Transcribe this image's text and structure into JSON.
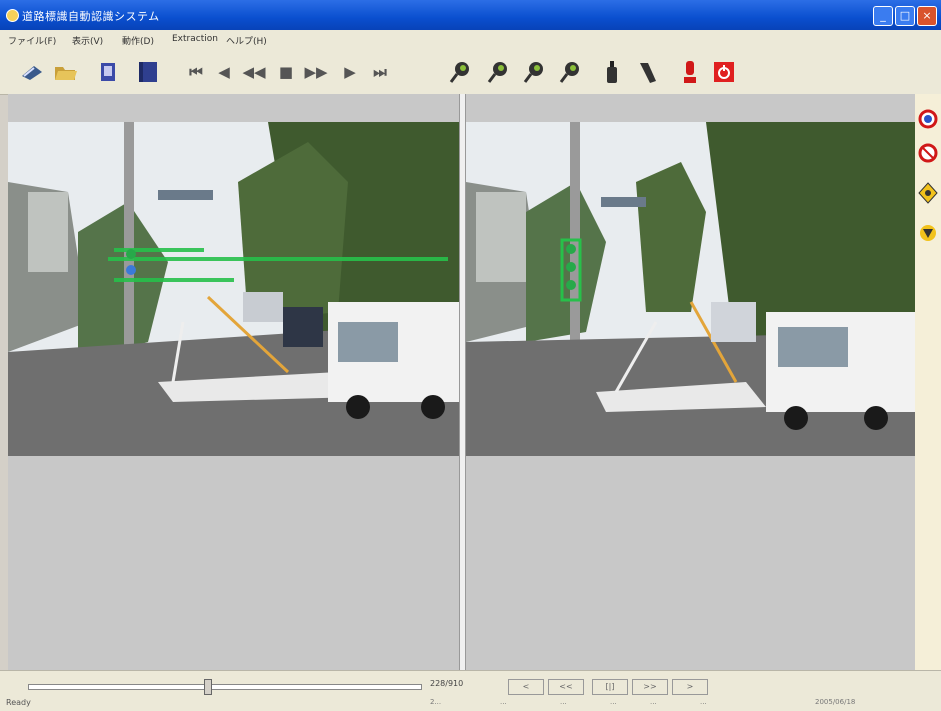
{
  "window": {
    "title": "道路標識自動認識システム",
    "minimize": "_",
    "maximize": "□",
    "close": "×"
  },
  "menu": [
    "ファイル(F)",
    "表示(V)",
    "動作(D)",
    "Extraction",
    "ヘルプ(H)"
  ],
  "toolbar_icons": [
    "open-icon",
    "folder-icon",
    "document-icon",
    "book-icon",
    "first-frame-icon",
    "prev-frame-icon",
    "rewind-icon",
    "stop-icon",
    "fast-forward-icon",
    "next-frame-icon",
    "last-frame-icon",
    "marker-1-icon",
    "marker-2-icon",
    "marker-3-icon",
    "marker-4-icon",
    "bottle-icon",
    "tilt-icon",
    "red-pin-icon",
    "power-icon"
  ],
  "side_signs": [
    "no-parking-sign-icon",
    "no-entry-sign-icon",
    "warning-sign-icon",
    "yield-sign-icon"
  ],
  "bottom": {
    "frame_counter": "228/910",
    "nav": [
      "<",
      "<<",
      "[|]",
      ">>",
      ">"
    ],
    "status": "Ready",
    "readouts": [
      "2...",
      "...",
      "...",
      "...",
      "...",
      "...",
      "2005/06/18"
    ]
  }
}
